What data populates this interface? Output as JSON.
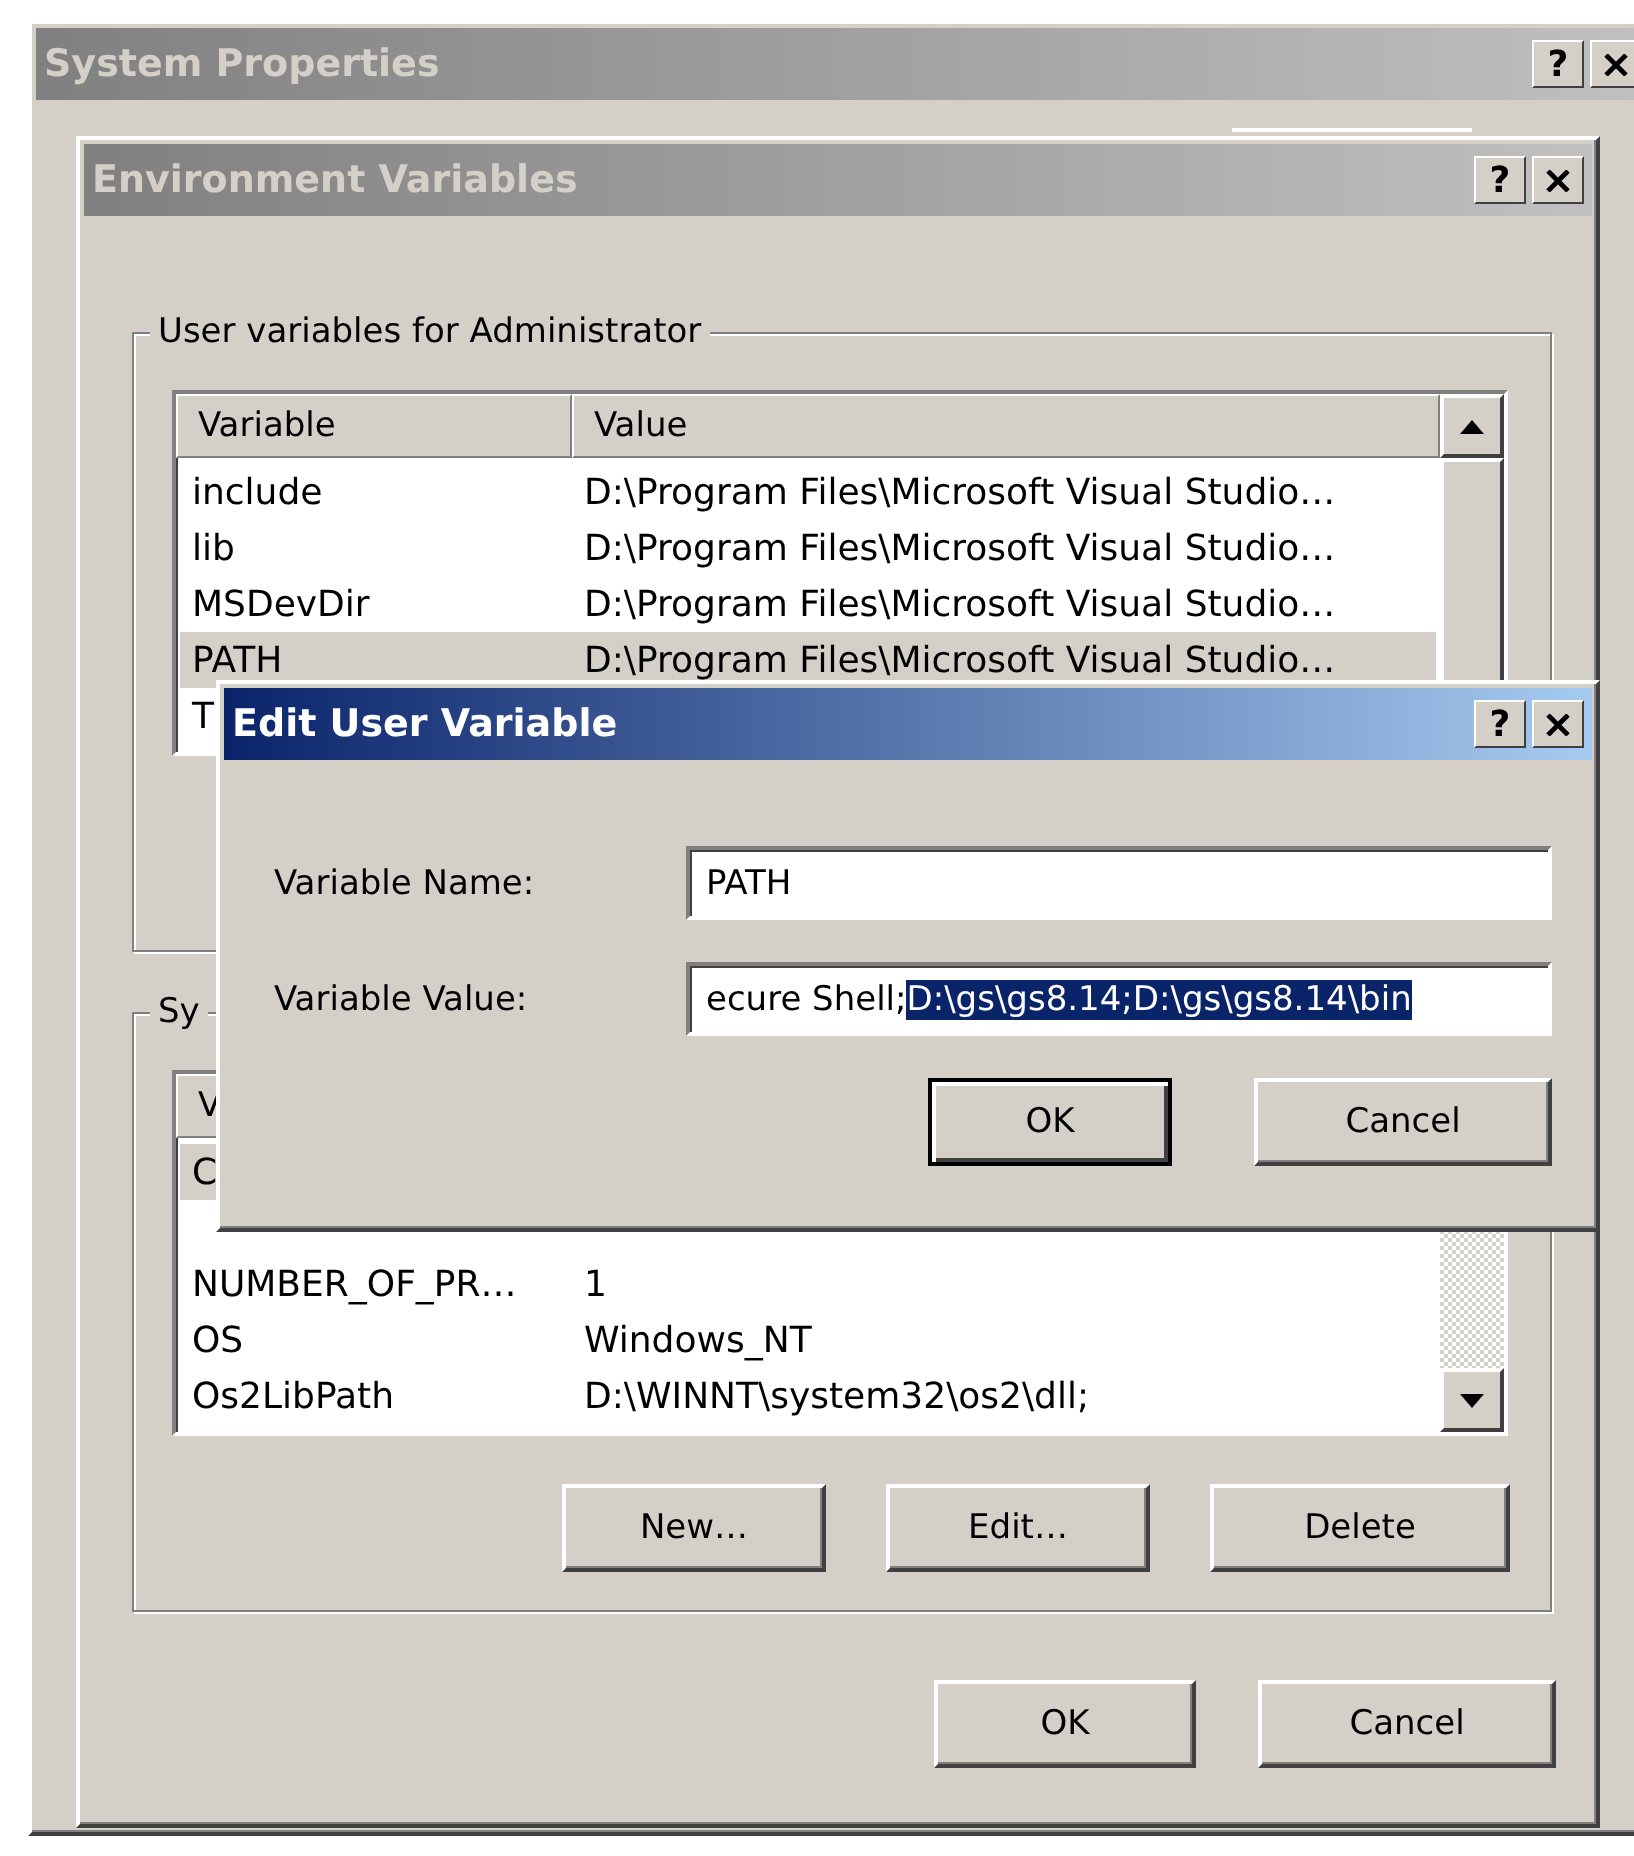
{
  "system_properties": {
    "title": "System Properties",
    "active": false,
    "help": "?"
  },
  "environment_variables": {
    "title": "Environment Variables",
    "active": false,
    "help": "?",
    "user_group": {
      "label": "User variables for Administrator",
      "columns": [
        "Variable",
        "Value"
      ],
      "rows": [
        {
          "variable": "include",
          "value": "D:\\Program Files\\Microsoft Visual Studio…",
          "selected": false
        },
        {
          "variable": "lib",
          "value": "D:\\Program Files\\Microsoft Visual Studio…",
          "selected": false
        },
        {
          "variable": "MSDevDir",
          "value": "D:\\Program Files\\Microsoft Visual Studio…",
          "selected": false
        },
        {
          "variable": "PATH",
          "value": "D:\\Program Files\\Microsoft Visual Studio…",
          "selected": true
        },
        {
          "variable": "T",
          "selected": false
        }
      ]
    },
    "system_group": {
      "label": "Sy",
      "columns": [
        "V"
      ],
      "rows": [
        {
          "variable": "C",
          "selected": true
        },
        {
          "selected": false
        },
        {
          "variable": "NUMBER_OF_PR…",
          "value": "1",
          "selected": false
        },
        {
          "variable": "OS",
          "value": "Windows_NT",
          "selected": false
        },
        {
          "variable": "Os2LibPath",
          "value": "D:\\WINNT\\system32\\os2\\dll;",
          "selected": false
        }
      ],
      "buttons": [
        "New…",
        "Edit…",
        "Delete"
      ]
    },
    "buttons": [
      "OK",
      "Cancel"
    ]
  },
  "edit_dialog": {
    "title": "Edit User Variable",
    "active": true,
    "help": "?",
    "fields": [
      {
        "label": "Variable Name:",
        "value": "PATH"
      },
      {
        "label": "Variable Value:",
        "value": "ecure Shell;",
        "selection": "D:\\gs\\gs8.14;D:\\gs\\gs8.14\\bin"
      }
    ],
    "buttons": [
      {
        "label": "OK",
        "default": true
      },
      {
        "label": "Cancel",
        "default": false
      }
    ]
  }
}
